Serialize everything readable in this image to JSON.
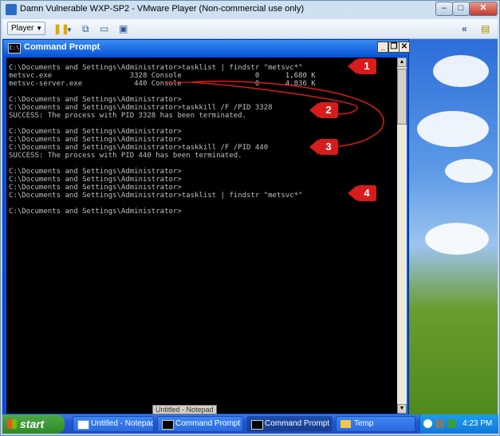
{
  "vm": {
    "title": "Damn Vulnerable WXP-SP2 - VMware Player (Non-commercial use only)",
    "player_label": "Player",
    "minimize": "–",
    "maximize": "□",
    "close": "✕",
    "toolbar_icons": [
      "pause-icon",
      "dropdown-icon",
      "network-icon",
      "fullscreen-icon",
      "unity-icon",
      "back-icon",
      "library-icon"
    ]
  },
  "cmd": {
    "title": "Command Prompt",
    "icon_text": "C:\\",
    "lines": [
      "C:\\Documents and Settings\\Administrator>tasklist | findstr \"metsvc*\"",
      "metsvc.exe                  3328 Console                 0      1,680 K",
      "metsvc-server.exe            440 Console                 0      4,836 K",
      "",
      "C:\\Documents and Settings\\Administrator>",
      "C:\\Documents and Settings\\Administrator>taskkill /F /PID 3328",
      "SUCCESS: The process with PID 3328 has been terminated.",
      "",
      "C:\\Documents and Settings\\Administrator>",
      "C:\\Documents and Settings\\Administrator>",
      "C:\\Documents and Settings\\Administrator>taskkill /F /PID 440",
      "SUCCESS: The process with PID 440 has been terminated.",
      "",
      "C:\\Documents and Settings\\Administrator>",
      "C:\\Documents and Settings\\Administrator>",
      "C:\\Documents and Settings\\Administrator>",
      "C:\\Documents and Settings\\Administrator>tasklist | findstr \"metsvc*\"",
      "",
      "C:\\Documents and Settings\\Administrator>"
    ]
  },
  "annotations": [
    "1",
    "2",
    "3",
    "4"
  ],
  "tooltip": "Untitled - Notepad",
  "taskbar": {
    "start_label": "start",
    "items": [
      {
        "label": "Untitled - Notepad",
        "icon": "notepad-icon"
      },
      {
        "label": "Command Prompt",
        "icon": "cmd-icon"
      },
      {
        "label": "Command Prompt",
        "icon": "cmd-icon"
      },
      {
        "label": "Temp",
        "icon": "folder-icon"
      }
    ],
    "clock": "4:23 PM"
  },
  "colors": {
    "annotation_red": "#d81b1b",
    "console_text": "#c0c0c0",
    "xp_blue": "#0054e3"
  }
}
